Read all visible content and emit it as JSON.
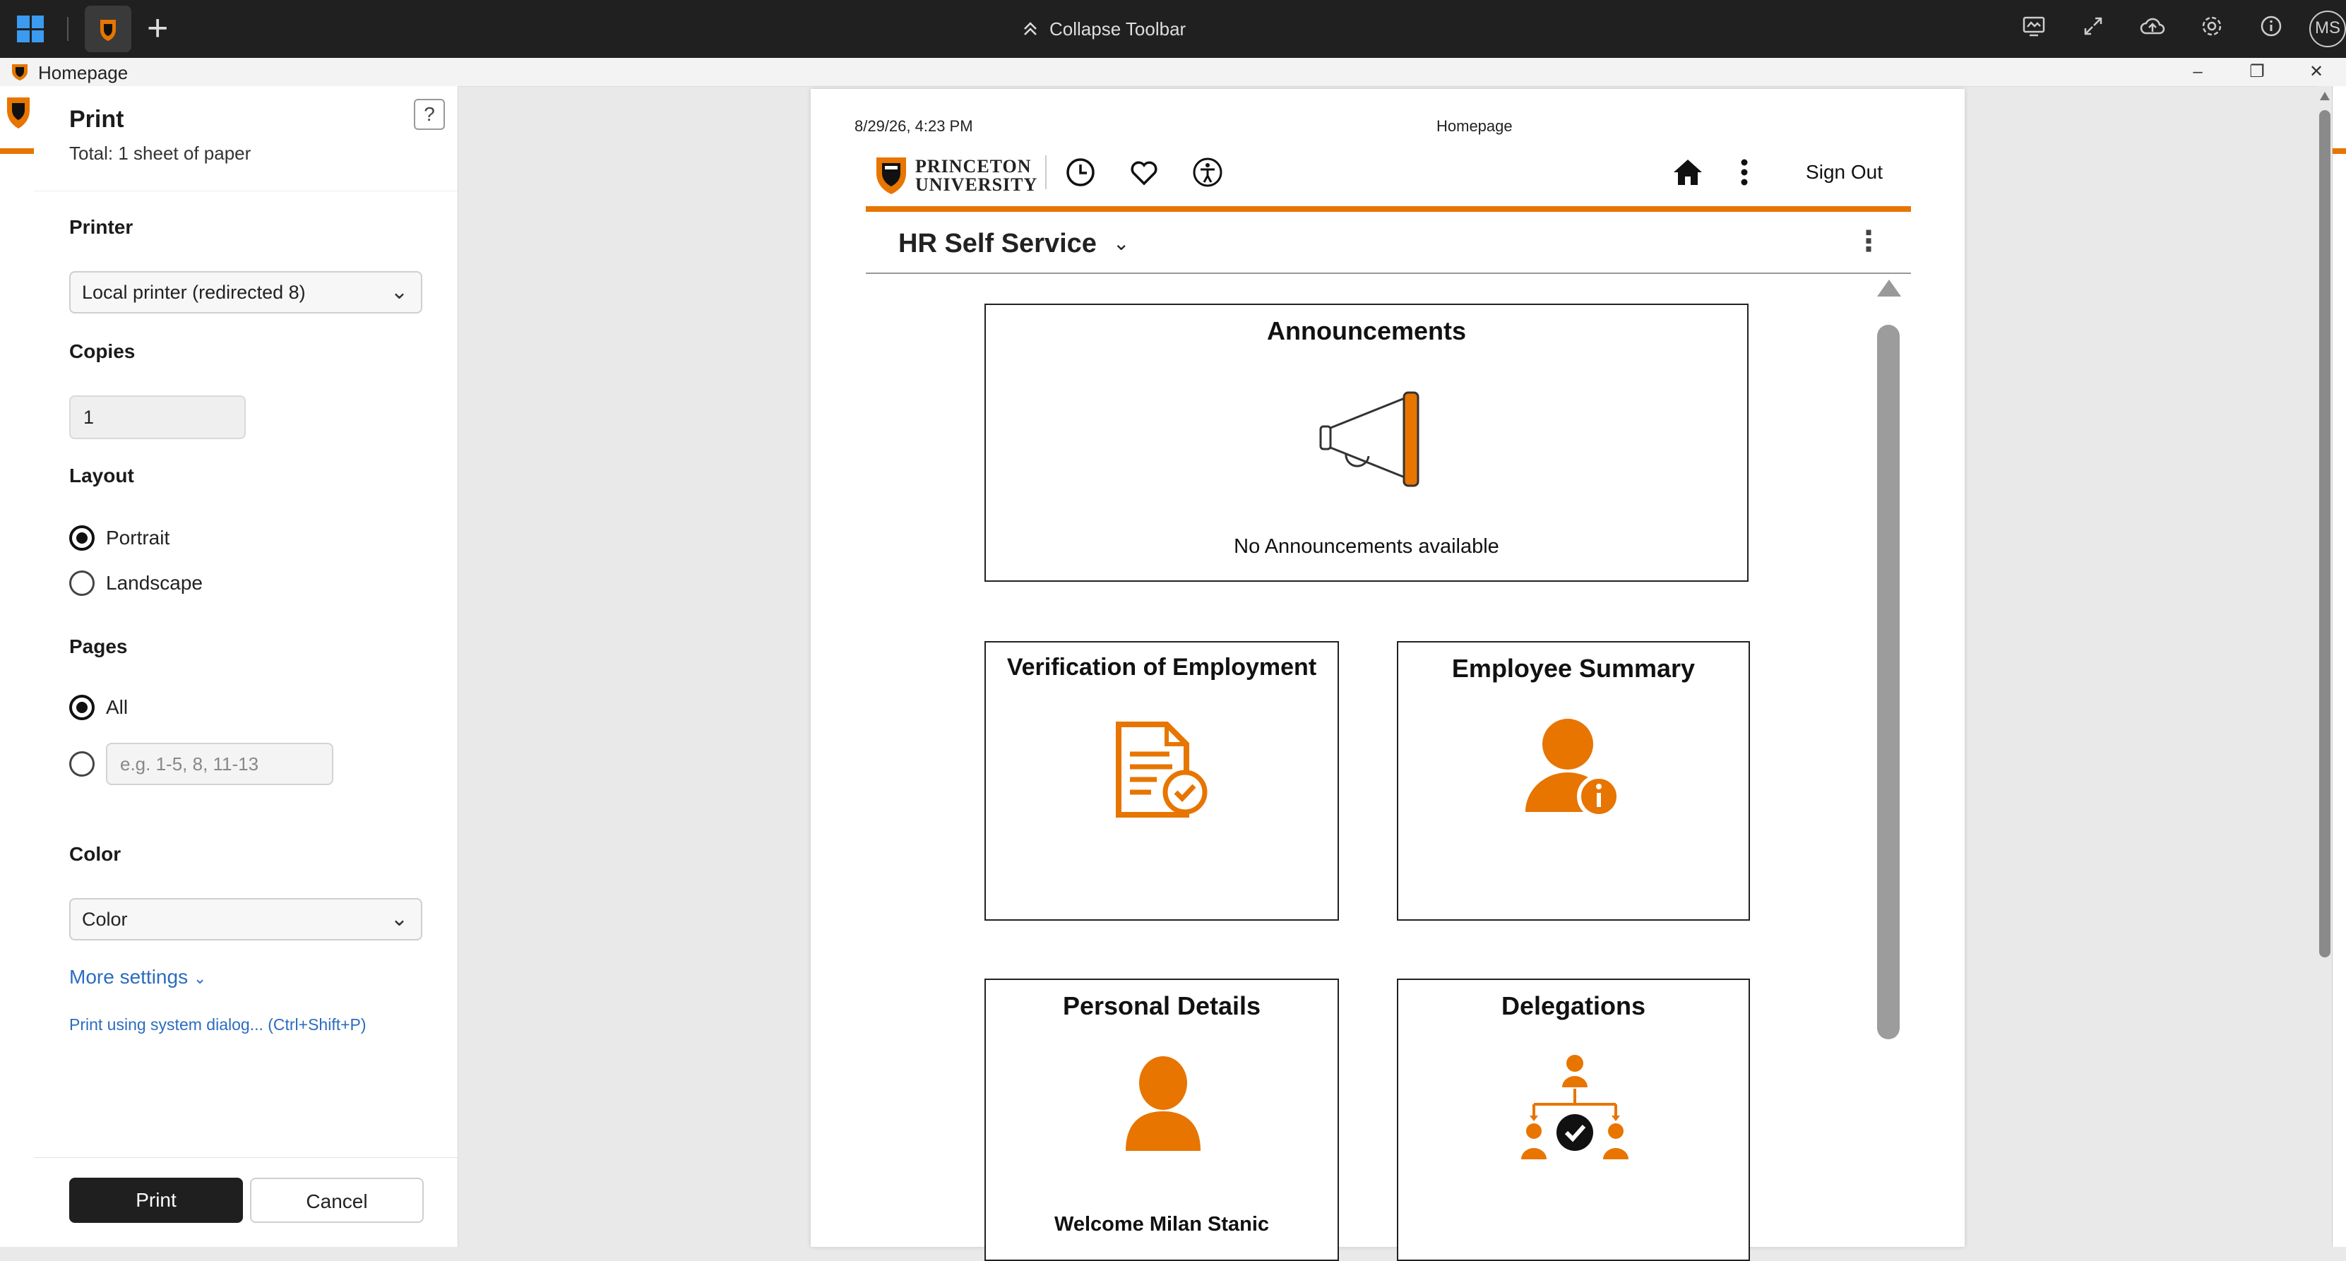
{
  "toolbar": {
    "collapse_label": "Collapse Toolbar",
    "avatar_initials": "MS",
    "icons": [
      "monitor-icon",
      "expand-icon",
      "cloud-upload-icon",
      "gear-icon",
      "info-icon",
      "close-icon"
    ]
  },
  "window": {
    "title": "Homepage"
  },
  "print_dialog": {
    "title": "Print",
    "total": "Total: 1 sheet of paper",
    "printer_label": "Printer",
    "printer_value": "Local printer (redirected 8)",
    "copies_label": "Copies",
    "copies_value": "1",
    "layout_label": "Layout",
    "layout_options": [
      "Portrait",
      "Landscape"
    ],
    "layout_selected": "Portrait",
    "pages_label": "Pages",
    "pages_all": "All",
    "pages_placeholder": "e.g. 1-5, 8, 11-13",
    "color_label": "Color",
    "color_value": "Color",
    "more_settings": "More settings",
    "system_dialog": "Print using system dialog... (Ctrl+Shift+P)",
    "print_button": "Print",
    "cancel_button": "Cancel"
  },
  "preview": {
    "timestamp": "8/29/26, 4:23 PM",
    "page_title": "Homepage",
    "logo_line1": "PRINCETON",
    "logo_line2": "UNIVERSITY",
    "sign_out": "Sign Out",
    "section_title": "HR Self Service",
    "accent_color": "#e77500",
    "tiles": {
      "announcements": {
        "title": "Announcements",
        "message": "No Announcements available"
      },
      "verification": {
        "title": "Verification of Employment"
      },
      "employee_summary": {
        "title": "Employee Summary"
      },
      "personal_details": {
        "title": "Personal Details",
        "message": "Welcome Milan Stanic"
      },
      "delegations": {
        "title": "Delegations"
      }
    }
  }
}
